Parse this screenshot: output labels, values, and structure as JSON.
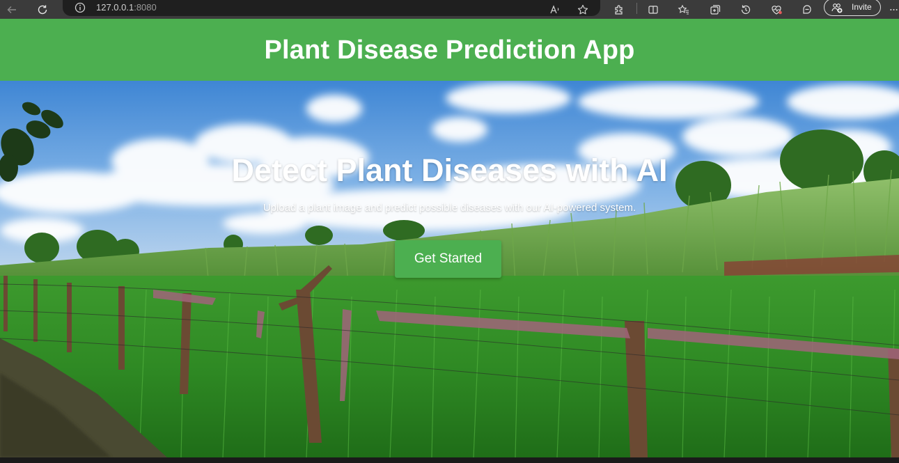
{
  "browser": {
    "url_host": "127.0.0.1",
    "url_port": ":8080",
    "invite_label": "Invite",
    "icons": [
      "back-icon",
      "refresh-icon",
      "info-icon",
      "read-aloud-icon",
      "favorite-star-icon",
      "extensions-icon",
      "split-screen-icon",
      "favorites-icon",
      "collections-icon",
      "history-icon",
      "performance-icon",
      "copilot-icon",
      "invite-icon",
      "more-icon"
    ]
  },
  "header": {
    "title": "Plant Disease Prediction App",
    "bg_color": "#4caf50"
  },
  "hero": {
    "heading": "Detect Plant Diseases with AI",
    "subtitle": "Upload a plant image and predict possible diseases with our AI-powered system.",
    "cta_label": "Get Started",
    "cta_color": "#4caf50"
  }
}
